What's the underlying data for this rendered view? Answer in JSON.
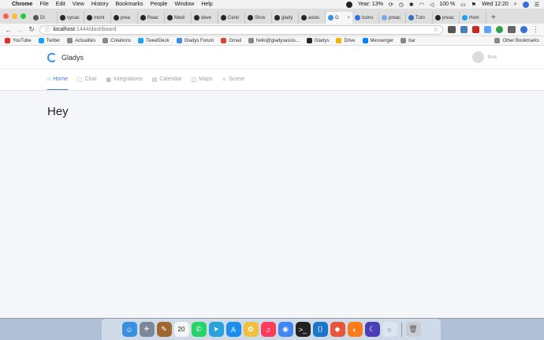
{
  "menubar": {
    "app_name": "Chrome",
    "items": [
      "File",
      "Edit",
      "View",
      "History",
      "Bookmarks",
      "People",
      "Window",
      "Help"
    ],
    "year_label": "Year: 13%",
    "battery": "100 %",
    "clock": "Wed 12:20"
  },
  "tabs": [
    {
      "title": "Di",
      "color": "#555"
    },
    {
      "title": "synac",
      "color": "#24292e"
    },
    {
      "title": "mont",
      "color": "#24292e"
    },
    {
      "title": "prea",
      "color": "#24292e"
    },
    {
      "title": "Reac",
      "color": "#24292e"
    },
    {
      "title": "Medi",
      "color": "#24292e"
    },
    {
      "title": "deve",
      "color": "#24292e"
    },
    {
      "title": "Centi",
      "color": "#24292e"
    },
    {
      "title": "Shov",
      "color": "#24292e"
    },
    {
      "title": "glady",
      "color": "#24292e"
    },
    {
      "title": "axios",
      "color": "#24292e"
    },
    {
      "title": "G",
      "color": "#3a8ee6",
      "active": true
    },
    {
      "title": "Icons",
      "color": "#2f6fe4"
    },
    {
      "title": "preac",
      "color": "#7aa7e6"
    },
    {
      "title": "Tuto",
      "color": "#3b72b8"
    },
    {
      "title": "preac",
      "color": "#24292e"
    },
    {
      "title": "Hom",
      "color": "#1da1f2"
    }
  ],
  "toolbar": {
    "url_host": "localhost",
    "url_path": ":1444/dashboard",
    "back": "←",
    "forward": "→",
    "reload": "↻"
  },
  "bookmarks": [
    {
      "label": "YouTube",
      "color": "#e52d27"
    },
    {
      "label": "Twitter",
      "color": "#1da1f2"
    },
    {
      "label": "Actualités",
      "color": "#888"
    },
    {
      "label": "Créations",
      "color": "#888"
    },
    {
      "label": "TweetDeck",
      "color": "#1da1f2"
    },
    {
      "label": "Gladys Forum",
      "color": "#3a8ee6"
    },
    {
      "label": "Gmail",
      "color": "#d44638"
    },
    {
      "label": "hello@gladysassis...",
      "color": "#888"
    },
    {
      "label": "Gladys",
      "color": "#24292e"
    },
    {
      "label": "Drive",
      "color": "#f4b400"
    },
    {
      "label": "Messenger",
      "color": "#0084ff"
    },
    {
      "label": "bar",
      "color": "#888"
    }
  ],
  "other_bookmarks": "Other Bookmarks",
  "app": {
    "brand": "Gladys",
    "user_name": "thue",
    "nav": [
      {
        "label": "Home",
        "icon": "⌂",
        "active": true
      },
      {
        "label": "Chat",
        "icon": "▢"
      },
      {
        "label": "Integrations",
        "icon": "▦"
      },
      {
        "label": "Calendar",
        "icon": "▤"
      },
      {
        "label": "Maps",
        "icon": "◫"
      },
      {
        "label": "Scene",
        "icon": "✧"
      }
    ],
    "page_title": "Hey"
  },
  "dock": [
    {
      "name": "finder",
      "color": "#3b8fe0",
      "glyph": "☺"
    },
    {
      "name": "launchpad",
      "color": "#7a8899",
      "glyph": "✈"
    },
    {
      "name": "notes",
      "color": "#a0682f",
      "glyph": "✎"
    },
    {
      "name": "calendar",
      "color": "#f5f5f5",
      "glyph": "20"
    },
    {
      "name": "whatsapp",
      "color": "#25d366",
      "glyph": "✆"
    },
    {
      "name": "telegram",
      "color": "#2aa1da",
      "glyph": "➤"
    },
    {
      "name": "app-store",
      "color": "#1c8ef0",
      "glyph": "A"
    },
    {
      "name": "photos",
      "color": "#f0c040",
      "glyph": "✿"
    },
    {
      "name": "music",
      "color": "#fb3c5a",
      "glyph": "♫"
    },
    {
      "name": "chrome",
      "color": "#4285f4",
      "glyph": "◉"
    },
    {
      "name": "terminal",
      "color": "#222",
      "glyph": ">_"
    },
    {
      "name": "vscode",
      "color": "#1b75c8",
      "glyph": "⟨⟩"
    },
    {
      "name": "paw",
      "color": "#e8553a",
      "glyph": "◆"
    },
    {
      "name": "firefox",
      "color": "#ff7a1a",
      "glyph": "◐"
    },
    {
      "name": "moon",
      "color": "#4a3fb5",
      "glyph": "☾"
    },
    {
      "name": "circle-app",
      "color": "#d9e6ef",
      "glyph": "○"
    },
    {
      "name": "trash",
      "color": "#c9cdd2",
      "glyph": "🗑"
    }
  ]
}
